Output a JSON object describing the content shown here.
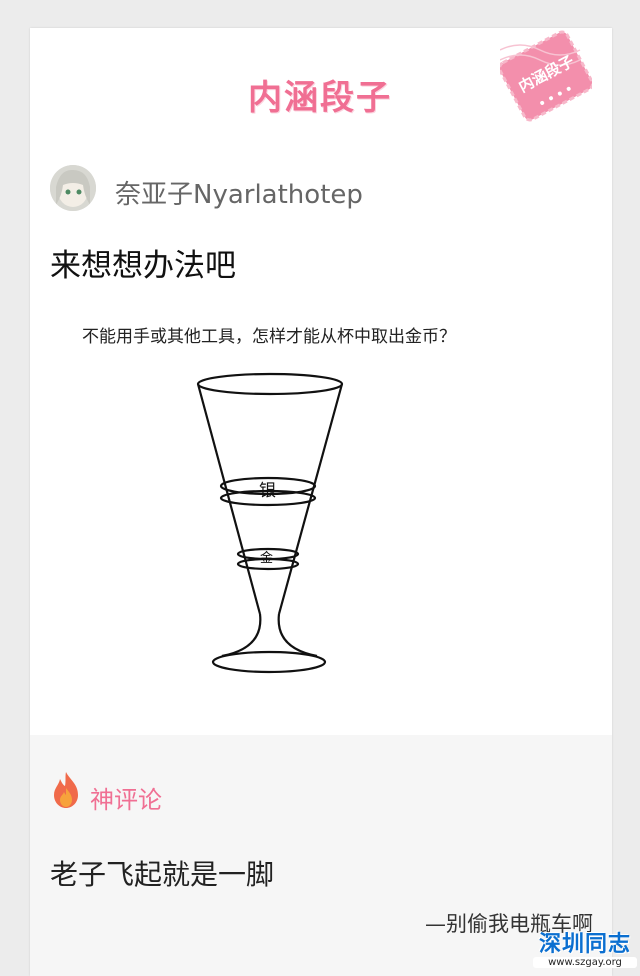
{
  "header": {
    "title": "内涵段子",
    "stamp_text": "内涵段子"
  },
  "post": {
    "username": "奈亚子Nyarlathotep",
    "title": "来想想办法吧",
    "puzzle": {
      "question": "不能用手或其他工具，怎样才能从杯中取出金币？",
      "upper_coin_label": "银",
      "lower_coin_label": "金"
    }
  },
  "comments": {
    "section_label": "神评论",
    "text": "老子飞起就是一脚",
    "author": "—别偷我电瓶车啊"
  },
  "watermark": {
    "name": "深圳同志",
    "url": "www.szgay.org"
  },
  "colors": {
    "brand_pink": "#f06f93",
    "watermark_blue": "#0b6fd0"
  },
  "icons": {
    "section": "flame-icon",
    "avatar": "user-avatar"
  }
}
